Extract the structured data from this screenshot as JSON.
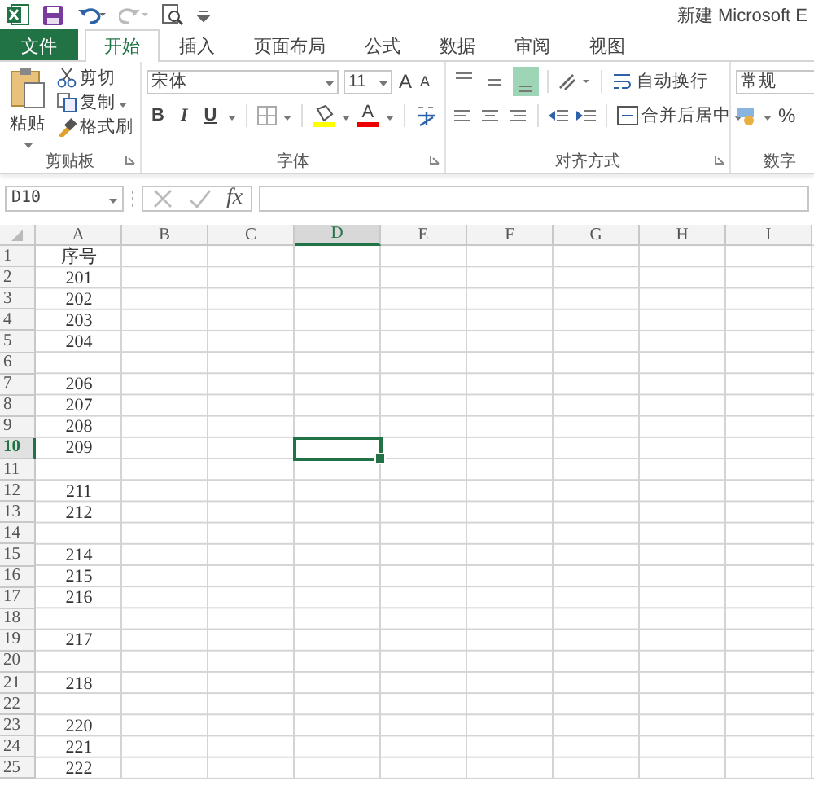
{
  "window": {
    "title": "新建 Microsoft E"
  },
  "tabs": [
    {
      "label": "文件",
      "kind": "file",
      "selected": false
    },
    {
      "label": "开始",
      "kind": "tab",
      "selected": true
    },
    {
      "label": "插入",
      "kind": "tab",
      "selected": false
    },
    {
      "label": "页面布局",
      "kind": "tab",
      "selected": false
    },
    {
      "label": "公式",
      "kind": "tab",
      "selected": false
    },
    {
      "label": "数据",
      "kind": "tab",
      "selected": false
    },
    {
      "label": "审阅",
      "kind": "tab",
      "selected": false
    },
    {
      "label": "视图",
      "kind": "tab",
      "selected": false
    }
  ],
  "ribbon": {
    "clipboard": {
      "paste": "粘贴",
      "cut": "剪切",
      "copy": "复制",
      "format_painter": "格式刷",
      "label": "剪贴板"
    },
    "font": {
      "font_name": "宋体",
      "font_size": "11",
      "grow": "A",
      "shrink": "A",
      "bold": "B",
      "italic": "I",
      "underline": "U",
      "font_color": "A",
      "label": "字体"
    },
    "alignment": {
      "vertical": [
        {
          "selected": false
        },
        {
          "selected": false
        },
        {
          "selected": true
        }
      ],
      "wrap_text": "自动换行",
      "merge_center": "合并后居中",
      "label": "对齐方式"
    },
    "number": {
      "format": "常规",
      "percent": "%",
      "label": "数字"
    }
  },
  "formula_bar": {
    "name_box": "D10",
    "function": "fx"
  },
  "sheet": {
    "columns": [
      {
        "label": "A",
        "selected": false
      },
      {
        "label": "B",
        "selected": false
      },
      {
        "label": "C",
        "selected": false
      },
      {
        "label": "D",
        "selected": true
      },
      {
        "label": "E",
        "selected": false
      },
      {
        "label": "F",
        "selected": false
      },
      {
        "label": "G",
        "selected": false
      },
      {
        "label": "H",
        "selected": false
      },
      {
        "label": "I",
        "selected": false
      }
    ],
    "rows": [
      {
        "number": "1",
        "cells": [
          "序号"
        ],
        "selected": false
      },
      {
        "number": "2",
        "cells": [
          "201"
        ],
        "selected": false
      },
      {
        "number": "3",
        "cells": [
          "202"
        ],
        "selected": false
      },
      {
        "number": "4",
        "cells": [
          "203"
        ],
        "selected": false
      },
      {
        "number": "5",
        "cells": [
          "204"
        ],
        "selected": false
      },
      {
        "number": "6",
        "cells": [],
        "selected": false
      },
      {
        "number": "7",
        "cells": [
          "206"
        ],
        "selected": false
      },
      {
        "number": "8",
        "cells": [
          "207"
        ],
        "selected": false
      },
      {
        "number": "9",
        "cells": [
          "208"
        ],
        "selected": false
      },
      {
        "number": "10",
        "cells": [
          "209"
        ],
        "selected": true
      },
      {
        "number": "11",
        "cells": [],
        "selected": false
      },
      {
        "number": "12",
        "cells": [
          "211"
        ],
        "selected": false
      },
      {
        "number": "13",
        "cells": [
          "212"
        ],
        "selected": false
      },
      {
        "number": "14",
        "cells": [],
        "selected": false
      },
      {
        "number": "15",
        "cells": [
          "214"
        ],
        "selected": false
      },
      {
        "number": "16",
        "cells": [
          "215"
        ],
        "selected": false
      },
      {
        "number": "17",
        "cells": [
          "216"
        ],
        "selected": false
      },
      {
        "number": "18",
        "cells": [],
        "selected": false
      },
      {
        "number": "19",
        "cells": [
          "217"
        ],
        "selected": false
      },
      {
        "number": "20",
        "cells": [],
        "selected": false
      },
      {
        "number": "21",
        "cells": [
          "218"
        ],
        "selected": false
      },
      {
        "number": "22",
        "cells": [],
        "selected": false
      },
      {
        "number": "23",
        "cells": [
          "220"
        ],
        "selected": false
      },
      {
        "number": "24",
        "cells": [
          "221"
        ],
        "selected": false
      },
      {
        "number": "25",
        "cells": [
          "222"
        ],
        "selected": false
      }
    ]
  }
}
